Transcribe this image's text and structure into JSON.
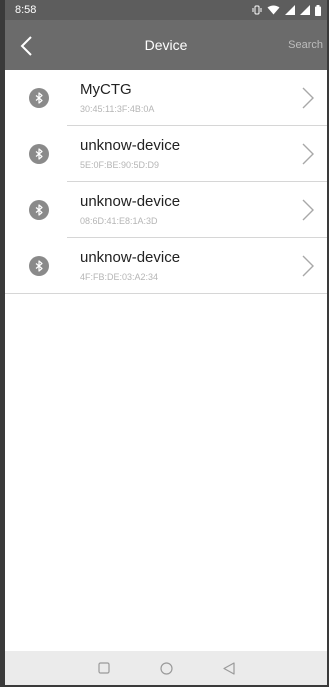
{
  "status_bar": {
    "time": "8:58",
    "icons": [
      "vibrate-icon",
      "wifi-icon",
      "signal-icon",
      "signal-icon",
      "battery-icon"
    ]
  },
  "app_bar": {
    "title": "Device",
    "search_label": "Search",
    "back_icon": "back-chevron-icon"
  },
  "devices": [
    {
      "name": "MyCTG",
      "mac": "30:45:11:3F:4B:0A",
      "icon": "bluetooth-icon"
    },
    {
      "name": "unknow-device",
      "mac": "5E:0F:BE:90:5D:D9",
      "icon": "bluetooth-icon"
    },
    {
      "name": "unknow-device",
      "mac": "08:6D:41:E8:1A:3D",
      "icon": "bluetooth-icon"
    },
    {
      "name": "unknow-device",
      "mac": "4F:FB:DE:03:A2:34",
      "icon": "bluetooth-icon"
    }
  ],
  "nav_bar": {
    "icons": [
      "recents-square-icon",
      "home-circle-icon",
      "back-triangle-icon"
    ]
  },
  "colors": {
    "status_bar": "#5d5d5d",
    "app_bar": "#6b6b6b",
    "icon_circle": "#8a8a8a",
    "divider": "#d6d6d6",
    "mac_text": "#b5b5b5"
  }
}
